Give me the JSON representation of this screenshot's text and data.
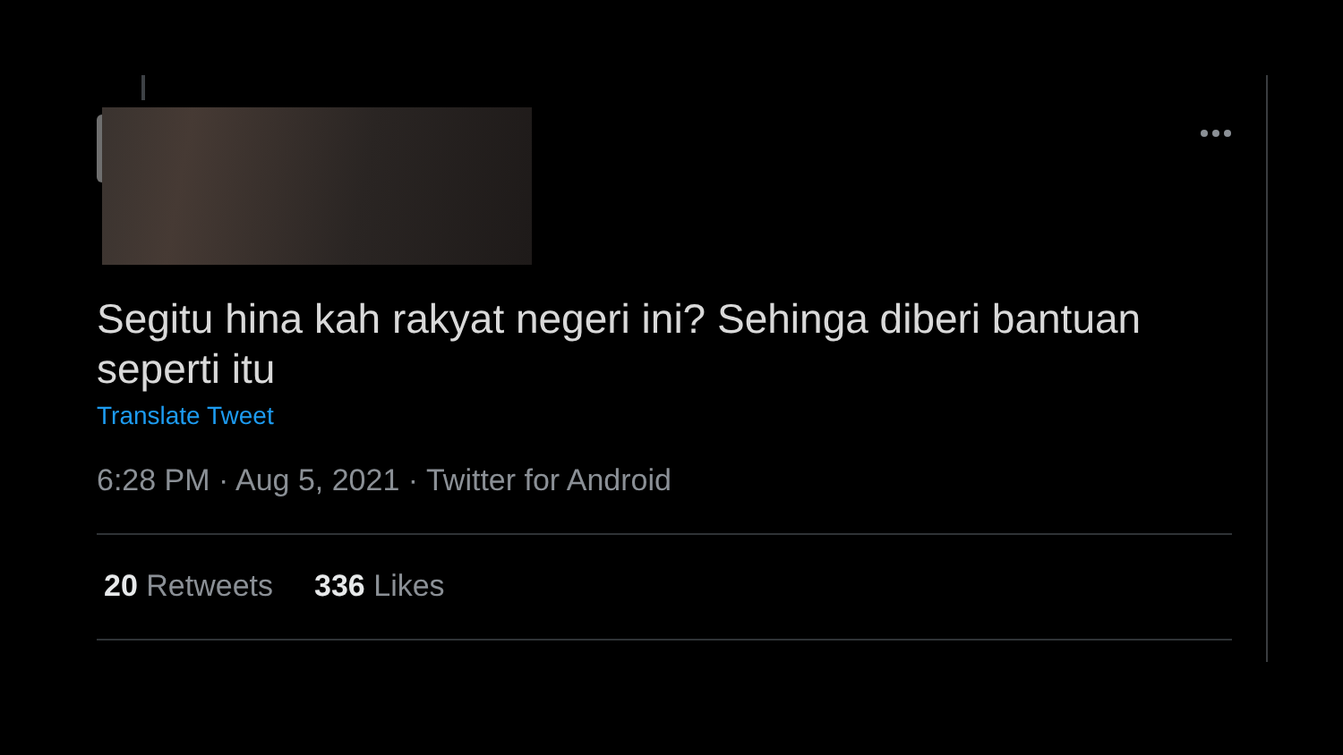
{
  "tweet": {
    "text": "Segitu hina kah rakyat negeri ini? Sehinga diberi bantuan seperti itu",
    "translate_link": "Translate Tweet",
    "meta": "6:28 PM · Aug 5, 2021 · Twitter for Android"
  },
  "stats": [
    {
      "count": "20",
      "label": "Retweets"
    },
    {
      "count": "336",
      "label": "Likes"
    }
  ]
}
